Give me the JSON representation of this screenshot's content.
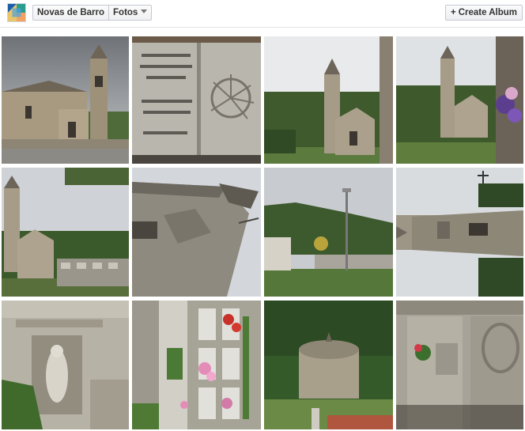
{
  "header": {
    "breadcrumb": [
      {
        "label": "Novas de Barro"
      },
      {
        "label": "Fotos"
      }
    ],
    "create_album_label": "Create Album",
    "create_album_icon": "plus-icon"
  },
  "photos": [
    {
      "subject": "church-exterior"
    },
    {
      "subject": "stone-inscription"
    },
    {
      "subject": "church-facade-hill"
    },
    {
      "subject": "church-tower-flowers"
    },
    {
      "subject": "church-cemetery"
    },
    {
      "subject": "facade-angled"
    },
    {
      "subject": "field-lamppost"
    },
    {
      "subject": "tower-rotated"
    },
    {
      "subject": "statue-niche"
    },
    {
      "subject": "cemetery-niches-flowers"
    },
    {
      "subject": "stone-mausoleum"
    },
    {
      "subject": "gravestone-flowers"
    }
  ]
}
